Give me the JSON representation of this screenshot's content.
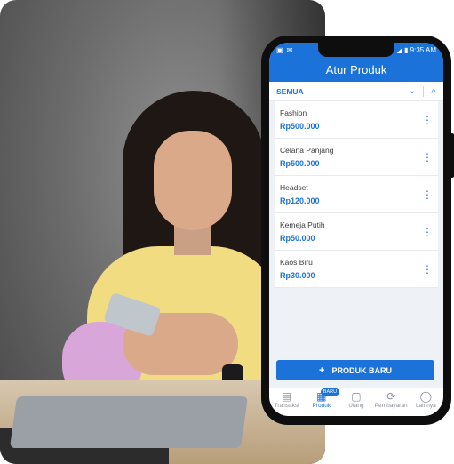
{
  "status": {
    "time": "9:35 AM"
  },
  "appbar": {
    "title": "Atur Produk"
  },
  "filter": {
    "label": "SEMUA"
  },
  "products": [
    {
      "name": "Fashion",
      "price": "Rp500.000"
    },
    {
      "name": "Celana Panjang",
      "price": "Rp500.000"
    },
    {
      "name": "Headset",
      "price": "Rp120.000"
    },
    {
      "name": "Kemeja Putih",
      "price": "Rp50.000"
    },
    {
      "name": "Kaos Biru",
      "price": "Rp30.000"
    }
  ],
  "new_button": {
    "label": "PRODUK BARU"
  },
  "nav": [
    {
      "label": "Transaksi",
      "icon": "receipt-icon"
    },
    {
      "label": "Produk",
      "icon": "box-icon",
      "badge": "BARU"
    },
    {
      "label": "Utang",
      "icon": "ledger-icon"
    },
    {
      "label": "Pembayaran",
      "icon": "refresh-icon"
    },
    {
      "label": "Lainnya",
      "icon": "user-icon"
    }
  ],
  "colors": {
    "primary": "#1b73d9"
  }
}
